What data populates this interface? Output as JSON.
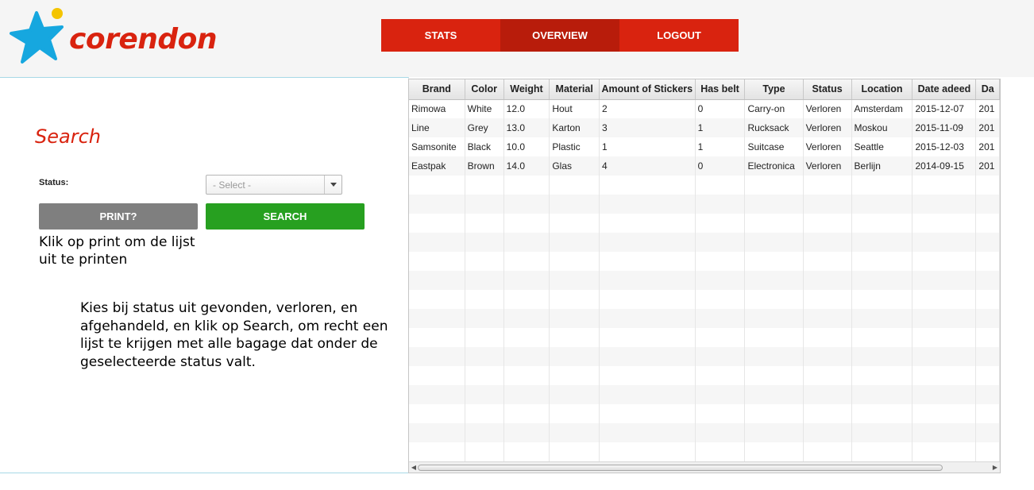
{
  "brand": {
    "name": "corendon",
    "star_color": "#16a7df",
    "dot_color": "#f4c400",
    "text_color": "#d9230f"
  },
  "nav": {
    "items": [
      {
        "label": "STATS"
      },
      {
        "label": "OVERVIEW",
        "active": true
      },
      {
        "label": "LOGOUT"
      }
    ]
  },
  "search": {
    "title": "Search",
    "status_label": "Status:",
    "status_select": {
      "selected": "- Select -"
    },
    "print_label": "PRINT?",
    "search_label": "SEARCH",
    "help_print": "Klik op print om de lijst uit te printen",
    "help_search": "Kies bij status uit gevonden, verloren, en afgehandeld, en klik op Search, om recht een lijst te krijgen met alle bagage dat onder de geselecteerde status valt."
  },
  "table": {
    "columns": [
      "Brand",
      "Color",
      "Weight",
      "Material",
      "Amount of Stickers",
      "Has belt",
      "Type",
      "Status",
      "Location",
      "Date adeed",
      "Da"
    ],
    "rows": [
      [
        "Rimowa",
        "White",
        "12.0",
        "Hout",
        "2",
        "0",
        "Carry-on",
        "Verloren",
        "Amsterdam",
        "2015-12-07",
        "201"
      ],
      [
        "Line",
        "Grey",
        "13.0",
        "Karton",
        "3",
        "1",
        "Rucksack",
        "Verloren",
        "Moskou",
        "2015-11-09",
        "201"
      ],
      [
        "Samsonite",
        "Black",
        "10.0",
        "Plastic",
        "1",
        "1",
        "Suitcase",
        "Verloren",
        "Seattle",
        "2015-12-03",
        "201"
      ],
      [
        "Eastpak",
        "Brown",
        "14.0",
        "Glas",
        "4",
        "0",
        "Electronica",
        "Verloren",
        "Berlijn",
        "2014-09-15",
        "201"
      ]
    ]
  }
}
